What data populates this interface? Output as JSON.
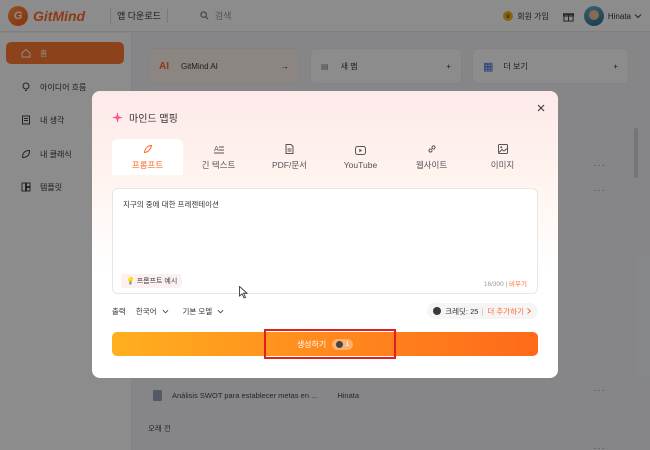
{
  "topbar": {
    "logo_text": "GitMind",
    "app_download": "앱 다운로드",
    "search_placeholder": "검색",
    "join_label": "회원 가입",
    "user_name": "Hinata"
  },
  "sidebar": {
    "items": [
      {
        "label": "홈",
        "icon": "home-icon"
      },
      {
        "label": "아이디어 흐름",
        "icon": "lightbulb-icon"
      },
      {
        "label": "내 생각",
        "icon": "notebook-icon"
      },
      {
        "label": "내 클래식",
        "icon": "leaf-icon"
      },
      {
        "label": "템플릿",
        "icon": "template-icon"
      }
    ]
  },
  "main": {
    "cards": [
      {
        "label": "GitMind AI",
        "badge": "AI"
      },
      {
        "label": "새 맵"
      },
      {
        "label": "더 보기"
      }
    ],
    "recent_row": {
      "title": "Análisis SWOT para establecer metas en ...",
      "owner": "Hinata"
    },
    "section_old": "오래 전"
  },
  "modal": {
    "title": "마인드 맵핑",
    "tabs": [
      {
        "label": "프롬프트",
        "icon": "feather-icon",
        "active": true
      },
      {
        "label": "긴 텍스트",
        "icon": "text-icon"
      },
      {
        "label": "PDF/문서",
        "icon": "document-icon"
      },
      {
        "label": "YouTube",
        "icon": "youtube-icon"
      },
      {
        "label": "웹사이트",
        "icon": "link-icon"
      },
      {
        "label": "이미지",
        "icon": "image-icon"
      }
    ],
    "prompt_text": "지구의 중에 대한 프레젠테이션",
    "example_chip": "프롬프트 예시",
    "counter": "16/300",
    "clear_label": "비우기",
    "output_label": "출력",
    "language": "한국어",
    "model": "기본 모델",
    "credit_label": "크레딧: 25",
    "add_more": "더 추가하기",
    "generate_label": "생성하기",
    "generate_cost": "1"
  },
  "colors": {
    "accent": "#ff6a2b",
    "highlight": "#e02020"
  }
}
